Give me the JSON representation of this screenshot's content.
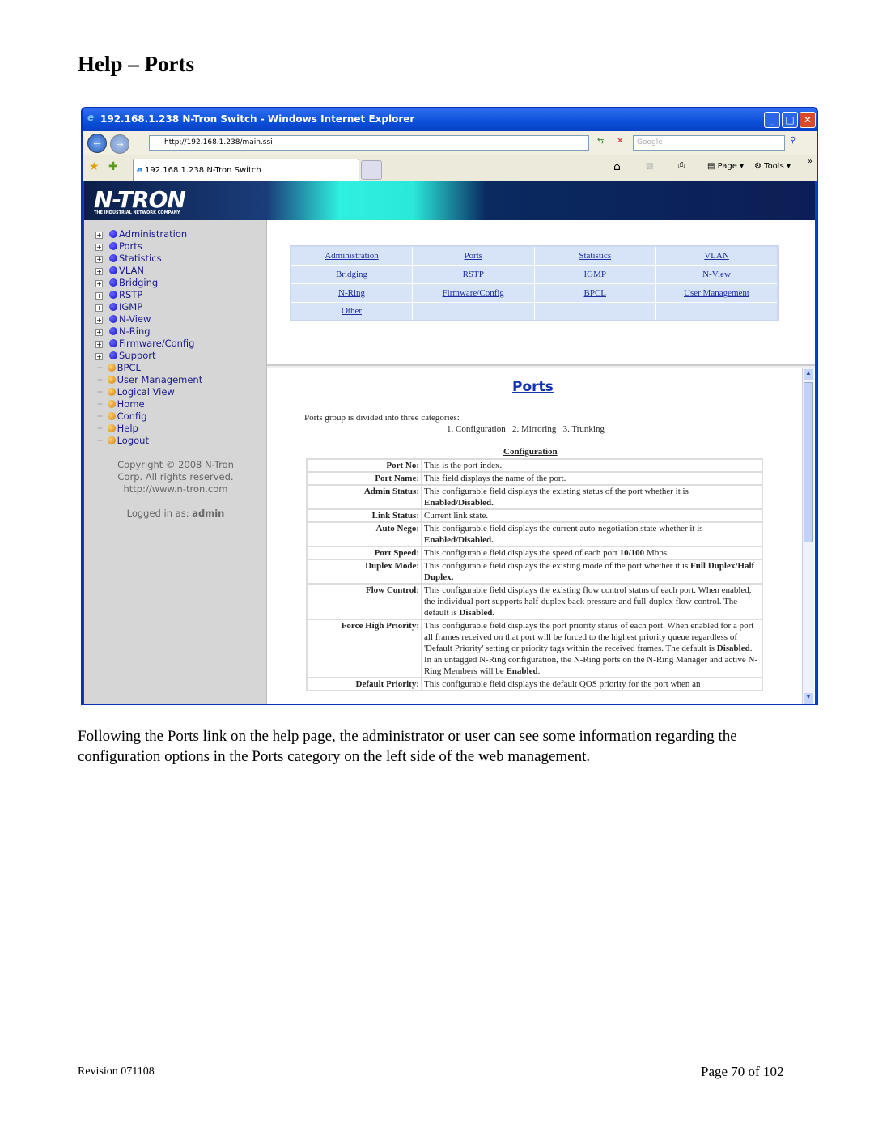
{
  "doc": {
    "title": "Help – Ports",
    "paragraph": "Following the Ports link on the help page, the administrator or user can see some information regarding the configuration options in the Ports category on the left side of the web management.",
    "revision": "Revision 071108",
    "page": "Page 70 of 102"
  },
  "browser": {
    "title": "192.168.1.238 N-Tron Switch - Windows Internet Explorer",
    "url": "http://192.168.1.238/main.ssi",
    "search_placeholder": "Google",
    "tab": "192.168.1.238 N-Tron Switch",
    "page_label": "Page",
    "tools_label": "Tools",
    "chevron": "»"
  },
  "banner": {
    "logo": "N-TRON",
    "tagline": "THE INDUSTRIAL NETWORK COMPANY"
  },
  "sidebar": {
    "tree": [
      "Administration",
      "Ports",
      "Statistics",
      "VLAN",
      "Bridging",
      "RSTP",
      "IGMP",
      "N-View",
      "N-Ring",
      "Firmware/Config",
      "Support"
    ],
    "links": [
      "BPCL",
      "User Management",
      "Logical View",
      "Home",
      "Config",
      "Help",
      "Logout"
    ],
    "copyright": [
      "Copyright © 2008 N-Tron",
      "Corp. All rights reserved.",
      "http://www.n-tron.com"
    ],
    "logged_in_label": "Logged in as:",
    "user": "admin",
    "colors": {
      "tree": "#1010c0",
      "link": "#d08010"
    }
  },
  "topnav": [
    [
      "Administration",
      "Ports",
      "Statistics",
      "VLAN"
    ],
    [
      "Bridging",
      "RSTP",
      "IGMP",
      "N-View"
    ],
    [
      "N-Ring",
      "Firmware/Config",
      "BPCL",
      "User Management"
    ],
    [
      "Other",
      "",
      "",
      ""
    ]
  ],
  "help": {
    "heading": "Ports",
    "intro": "Ports group is divided into three categories:",
    "categories": "1. Configuration   2. Mirroring   3. Trunking",
    "section": "Configuration",
    "rows": [
      {
        "k": "Port No:",
        "d": [
          [
            "This is the port index.",
            0
          ]
        ]
      },
      {
        "k": "Port Name:",
        "d": [
          [
            "This field displays the name of the port.",
            0
          ]
        ]
      },
      {
        "k": "Admin Status:",
        "d": [
          [
            "This configurable field displays the existing status of the port whether it is ",
            0
          ],
          [
            "Enabled/Disabled.",
            1
          ]
        ]
      },
      {
        "k": "Link Status:",
        "d": [
          [
            "Current link state.",
            0
          ]
        ]
      },
      {
        "k": "Auto Nego:",
        "d": [
          [
            "This configurable field displays the current auto-negotiation state whether it is ",
            0
          ],
          [
            "Enabled/Disabled.",
            1
          ]
        ]
      },
      {
        "k": "Port Speed:",
        "d": [
          [
            "This configurable field displays the speed of each port ",
            0
          ],
          [
            "10/100",
            1
          ],
          [
            " Mbps.",
            0
          ]
        ]
      },
      {
        "k": "Duplex Mode:",
        "d": [
          [
            "This configurable field displays the existing mode of the port whether it is ",
            0
          ],
          [
            "Full Duplex/Half Duplex.",
            1
          ]
        ]
      },
      {
        "k": "Flow Control:",
        "d": [
          [
            "This configurable field displays the existing flow control status of each port. When enabled, the individual port supports half-duplex back pressure and full-duplex flow control. The default is ",
            0
          ],
          [
            "Disabled.",
            1
          ]
        ]
      },
      {
        "k": "Force High Priority:",
        "d": [
          [
            "This configurable field displays the port priority status of each port. When enabled for a port all frames received on that port will be forced to the highest priority queue regardless of 'Default Priority' setting or priority tags within the received frames. The default is ",
            0
          ],
          [
            "Disabled",
            1
          ],
          [
            ". In an untagged N-Ring configuration, the N-Ring ports on the N-Ring Manager and active N-Ring Members will be ",
            0
          ],
          [
            "Enabled",
            1
          ],
          [
            ".",
            0
          ]
        ]
      },
      {
        "k": "Default Priority:",
        "d": [
          [
            "This configurable field displays the default QOS priority for the port when an",
            0
          ]
        ]
      }
    ]
  }
}
